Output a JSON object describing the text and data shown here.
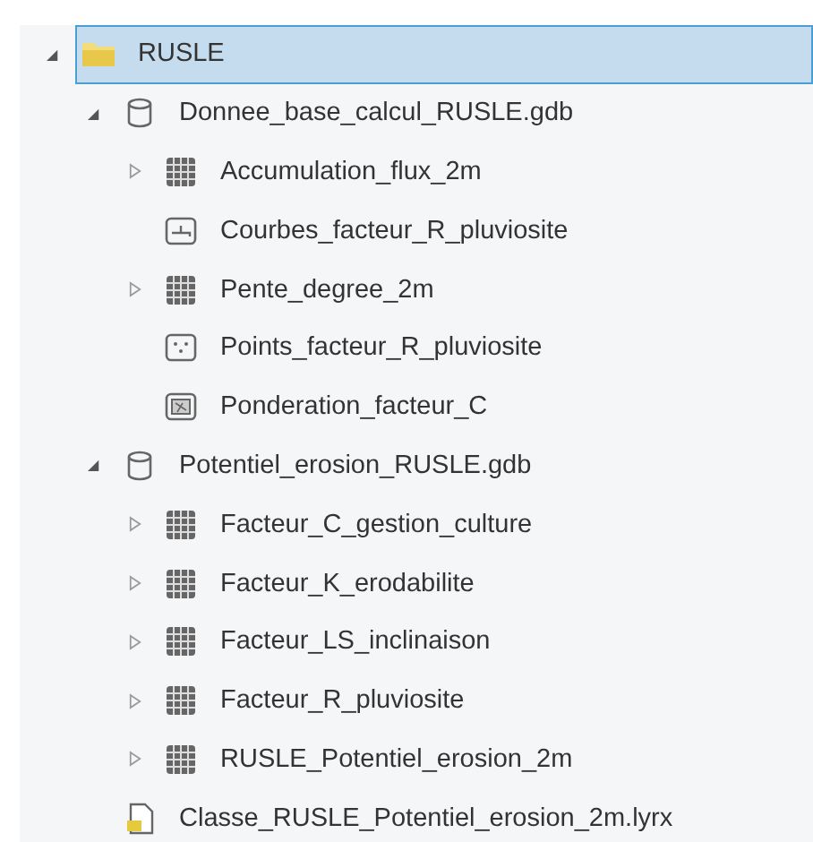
{
  "tree": [
    {
      "label": "RUSLE",
      "kind": "folder",
      "expanded": true,
      "selected": true,
      "children": [
        {
          "label": "Donnee_base_calcul_RUSLE.gdb",
          "kind": "database",
          "expanded": true,
          "selected": false,
          "children": [
            {
              "label": "Accumulation_flux_2m",
              "kind": "raster",
              "expanded": false,
              "selected": false
            },
            {
              "label": "Courbes_facteur_R_pluviosite",
              "kind": "line",
              "selected": false
            },
            {
              "label": "Pente_degree_2m",
              "kind": "raster",
              "expanded": false,
              "selected": false
            },
            {
              "label": "Points_facteur_R_pluviosite",
              "kind": "point",
              "selected": false
            },
            {
              "label": "Ponderation_facteur_C",
              "kind": "polygon",
              "selected": false
            }
          ]
        },
        {
          "label": "Potentiel_erosion_RUSLE.gdb",
          "kind": "database",
          "expanded": true,
          "selected": false,
          "children": [
            {
              "label": "Facteur_C_gestion_culture",
              "kind": "raster",
              "expanded": false,
              "selected": false
            },
            {
              "label": "Facteur_K_erodabilite",
              "kind": "raster",
              "expanded": false,
              "selected": false
            },
            {
              "label": "Facteur_LS_inclinaison",
              "kind": "raster",
              "expanded": false,
              "selected": false
            },
            {
              "label": "Facteur_R_pluviosite",
              "kind": "raster",
              "expanded": false,
              "selected": false
            },
            {
              "label": "RUSLE_Potentiel_erosion_2m",
              "kind": "raster",
              "expanded": false,
              "selected": false
            }
          ]
        },
        {
          "label": "Classe_RUSLE_Potentiel_erosion_2m.lyrx",
          "kind": "layerfile",
          "selected": false
        }
      ]
    }
  ]
}
